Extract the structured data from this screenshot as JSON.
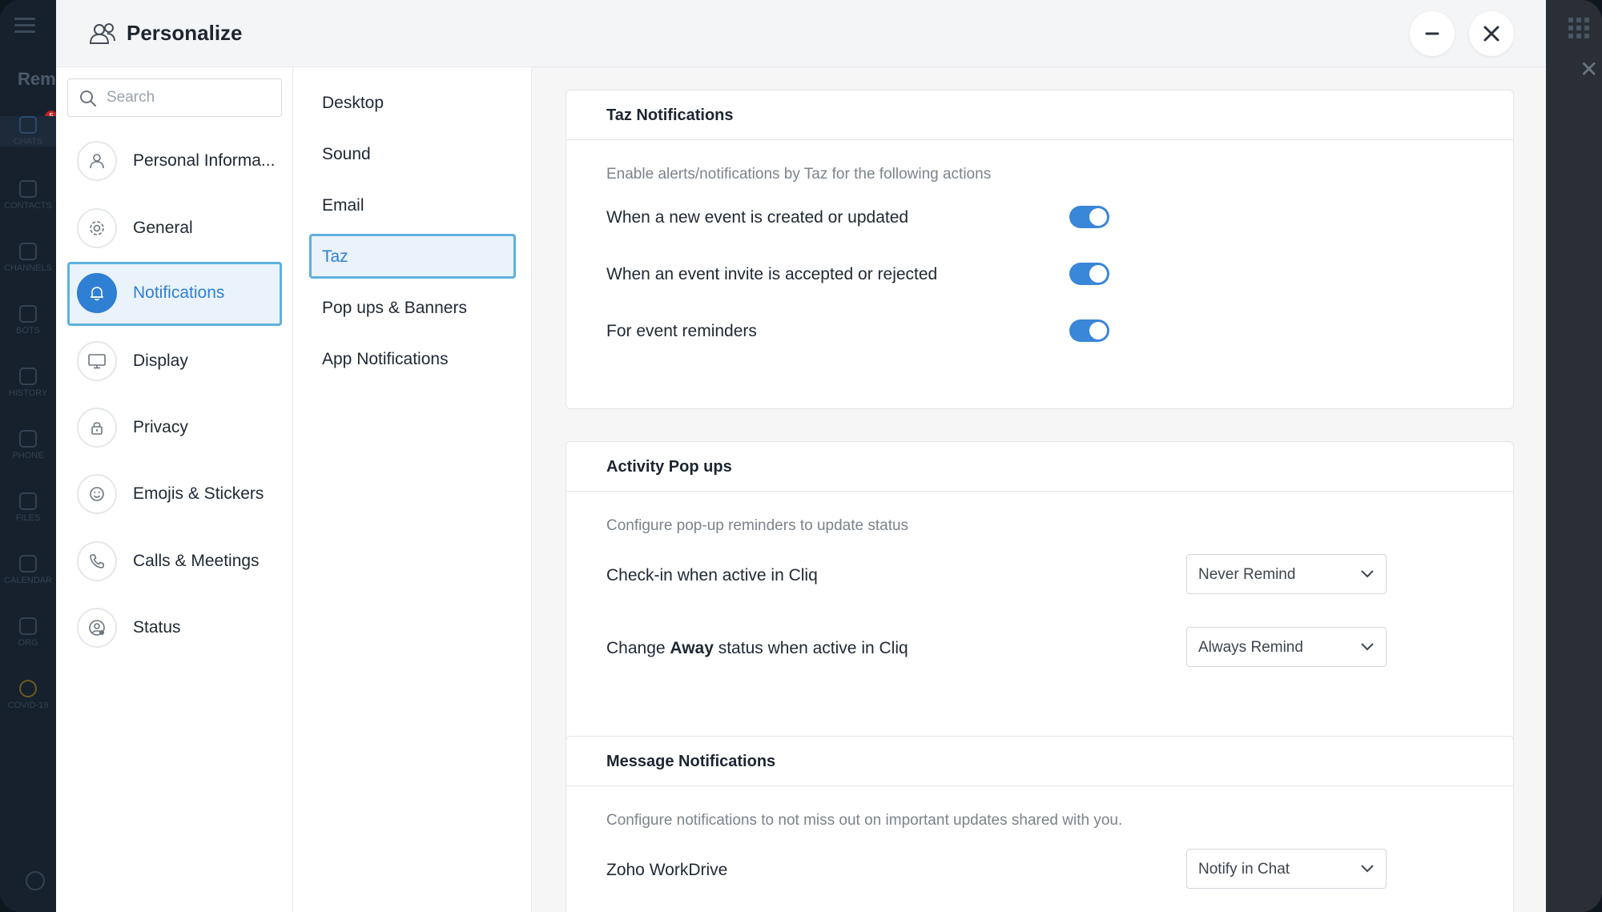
{
  "modal": {
    "title": "Personalize"
  },
  "search": {
    "placeholder": "Search"
  },
  "background_app": {
    "brand": "Rem",
    "badge": "5",
    "rail": [
      "CHATS",
      "CONTACTS",
      "CHANNELS",
      "BOTS",
      "HISTORY",
      "PHONE",
      "FILES",
      "CALENDAR",
      "ORG",
      "COVID-19"
    ]
  },
  "sidebar": {
    "items": [
      {
        "label": "Personal Informa...",
        "icon": "user-icon"
      },
      {
        "label": "General",
        "icon": "gear-icon"
      },
      {
        "label": "Notifications",
        "icon": "bell-icon",
        "active": true
      },
      {
        "label": "Display",
        "icon": "monitor-icon"
      },
      {
        "label": "Privacy",
        "icon": "lock-icon"
      },
      {
        "label": "Emojis & Stickers",
        "icon": "smiley-icon"
      },
      {
        "label": "Calls & Meetings",
        "icon": "phone-icon"
      },
      {
        "label": "Status",
        "icon": "status-icon"
      }
    ]
  },
  "submenu": {
    "items": [
      {
        "label": "Desktop"
      },
      {
        "label": "Sound"
      },
      {
        "label": "Email"
      },
      {
        "label": "Taz",
        "active": true
      },
      {
        "label": "Pop ups & Banners"
      },
      {
        "label": "App Notifications"
      }
    ]
  },
  "taz": {
    "title": "Taz Notifications",
    "description": "Enable alerts/notifications by Taz for the following actions",
    "rows": [
      {
        "label": "When a new event is created or updated",
        "enabled": true
      },
      {
        "label": "When an event invite is accepted or rejected",
        "enabled": true
      },
      {
        "label": "For event reminders",
        "enabled": true
      }
    ]
  },
  "activity": {
    "title": "Activity Pop ups",
    "description": "Configure pop-up reminders to update status",
    "checkin": {
      "label": "Check-in when active in Cliq",
      "value": "Never Remind"
    },
    "away": {
      "label_pre": "Change ",
      "label_bold": "Away",
      "label_post": " status when active in Cliq",
      "value": "Always Remind"
    }
  },
  "message": {
    "title": "Message Notifications",
    "description": "Configure notifications to not miss out on important updates shared with you.",
    "workdrive": {
      "label": "Zoho WorkDrive",
      "value": "Notify in Chat"
    }
  },
  "colors": {
    "accent": "#2f7fd3",
    "active_border": "#5fb0e0",
    "active_bg": "#eaf3fb",
    "toggle_on": "#3a86d8"
  }
}
